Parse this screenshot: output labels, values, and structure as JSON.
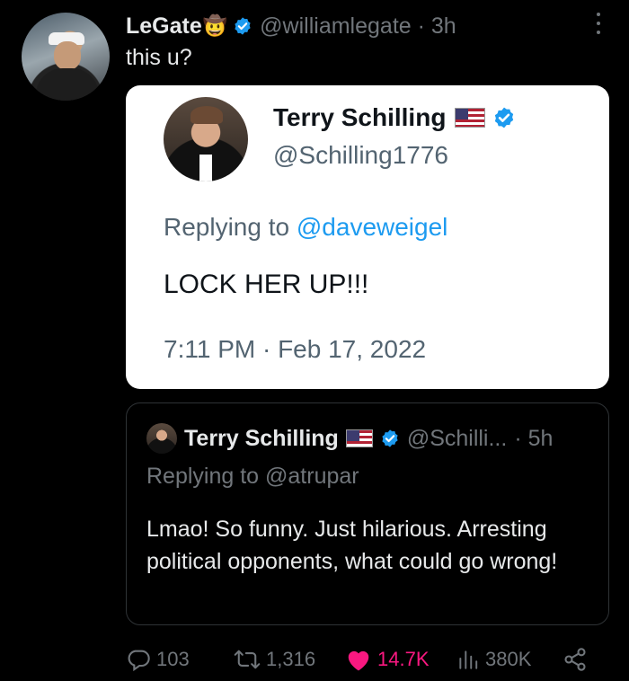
{
  "tweet": {
    "author_name": "LeGate",
    "author_emoji": "🤠",
    "handle": "@williamlegate",
    "time": "· 3h",
    "text": "this u?"
  },
  "embedded_screenshot": {
    "name": "Terry Schilling",
    "handle": "@Schilling1776",
    "replying_prefix": "Replying to ",
    "replying_handle": "@daveweigel",
    "text": "LOCK HER UP!!!",
    "date": "7:11 PM · Feb 17, 2022"
  },
  "quoted_tweet": {
    "name": "Terry Schilling",
    "handle": "@Schilli...",
    "time": "· 5h",
    "replying": "Replying to @atrupar",
    "text": "Lmao! So funny. Just hilarious. Arresting political opponents, what could go wrong!"
  },
  "actions": {
    "replies": "103",
    "retweets": "1,316",
    "likes": "14.7K",
    "views": "380K"
  },
  "colors": {
    "background": "#000000",
    "verified": "#1d9bf0",
    "like": "#f91880",
    "muted": "#71767b"
  }
}
